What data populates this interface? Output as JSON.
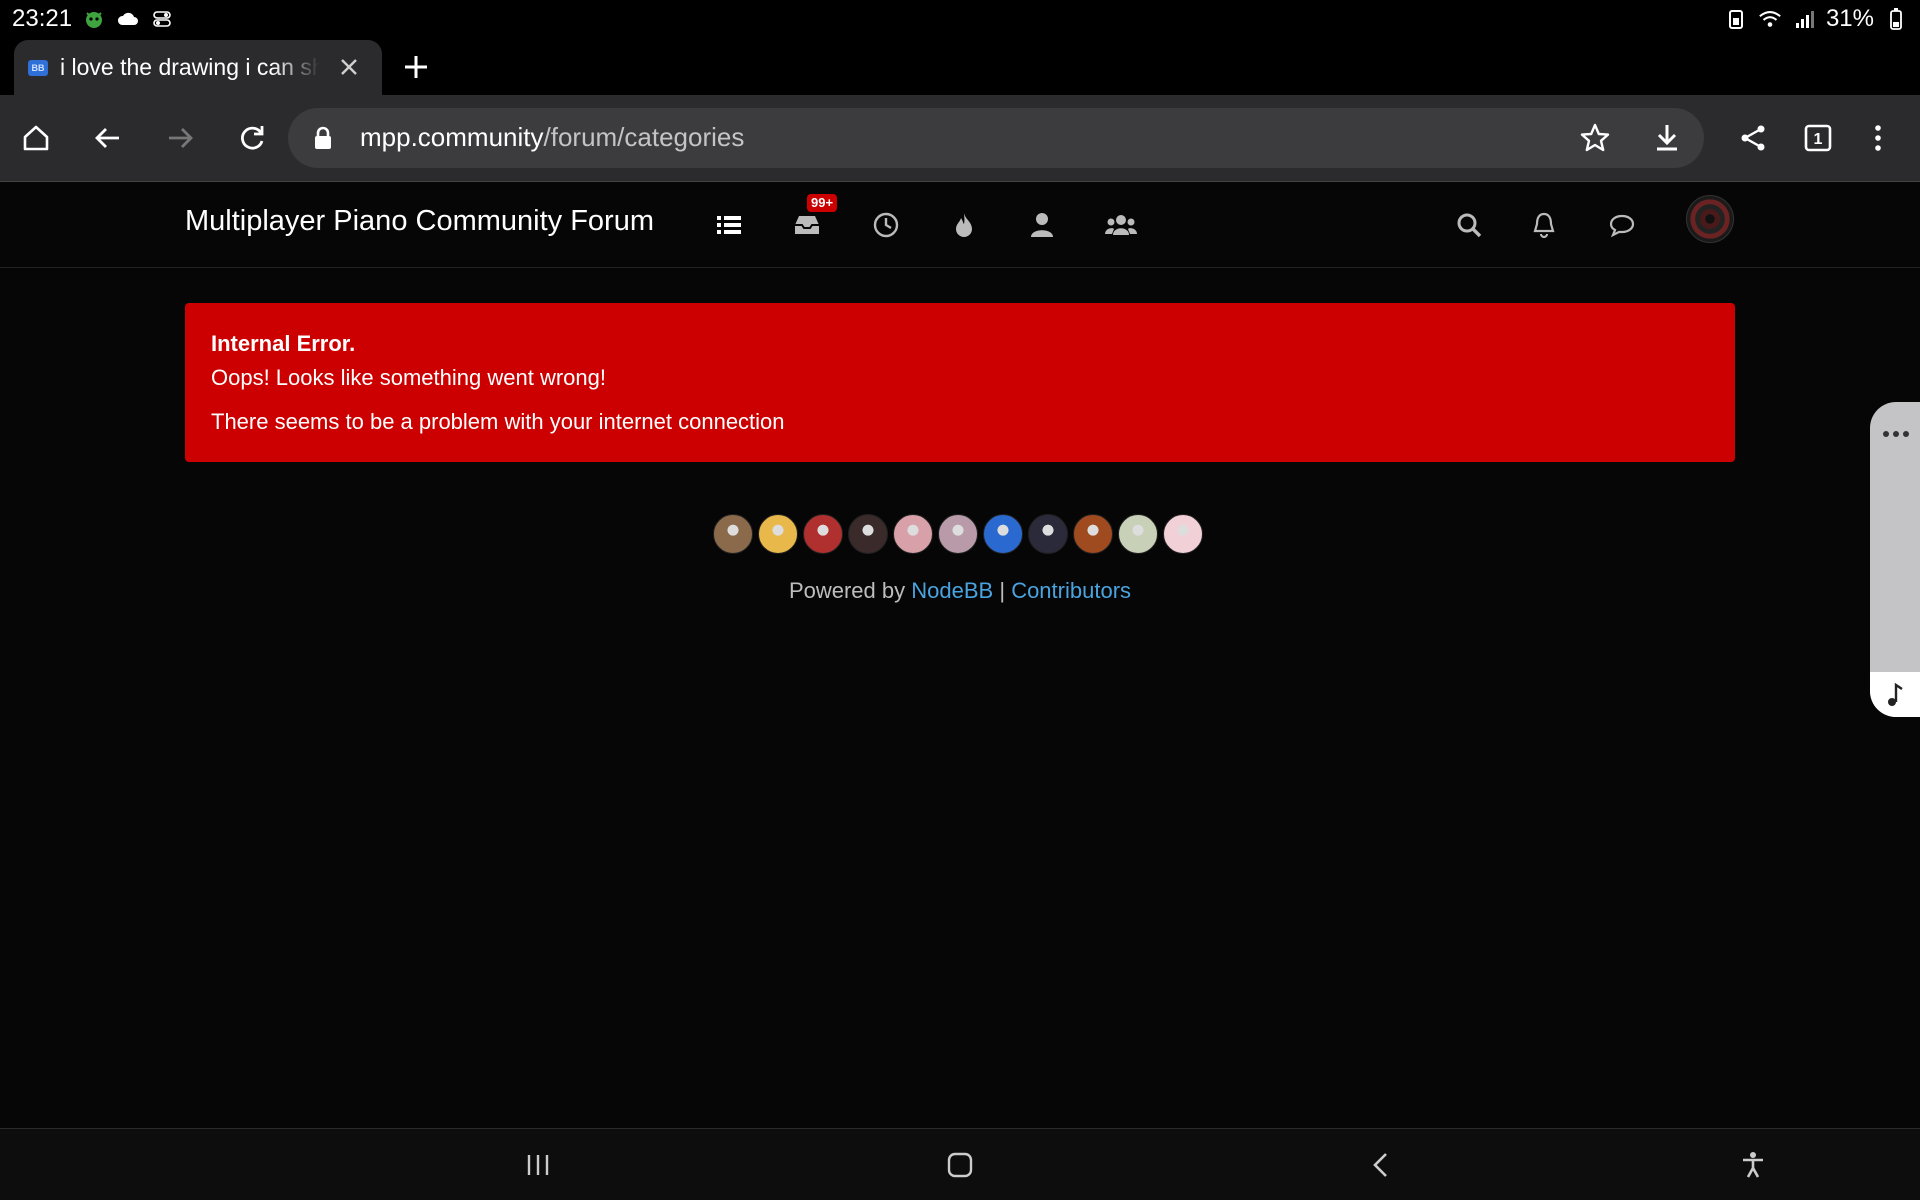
{
  "status_bar": {
    "time": "23:21",
    "battery": "31%",
    "icons": [
      "game-icon",
      "cloud-icon",
      "toggle-icon",
      "battery-saver-icon",
      "wifi-icon",
      "signal-icon",
      "battery-icon"
    ]
  },
  "tab": {
    "title": "i love the drawing i can share",
    "favicon": "BB"
  },
  "toolbar": {
    "url_host": "mpp.community",
    "url_path": "/forum/categories",
    "tab_count": "1"
  },
  "site": {
    "brand": "Multiplayer Piano Community Forum",
    "unread_badge": "99+",
    "nav_icons": [
      "categories-icon",
      "unread-icon",
      "recent-icon",
      "popular-icon",
      "users-icon",
      "groups-icon"
    ]
  },
  "alert": {
    "title": "Internal Error.",
    "message": "Oops! Looks like something went wrong!",
    "detail": "There seems to be a problem with your internet connection"
  },
  "footer": {
    "powered_by": "Powered by",
    "nodebb": "NodeBB",
    "separator": "|",
    "contributors": "Contributors",
    "contributor_avatar_colors": [
      "#8a6a4a",
      "#e8b84a",
      "#b03030",
      "#3a2a2a",
      "#d8a0a8",
      "#b89aa8",
      "#2a6ad0",
      "#2a2a3a",
      "#a04a20",
      "#c8d0b8",
      "#f2d0d8"
    ]
  },
  "colors": {
    "alert_bg": "#cc0000",
    "link": "#4aa3df",
    "page_bg": "#060606"
  }
}
